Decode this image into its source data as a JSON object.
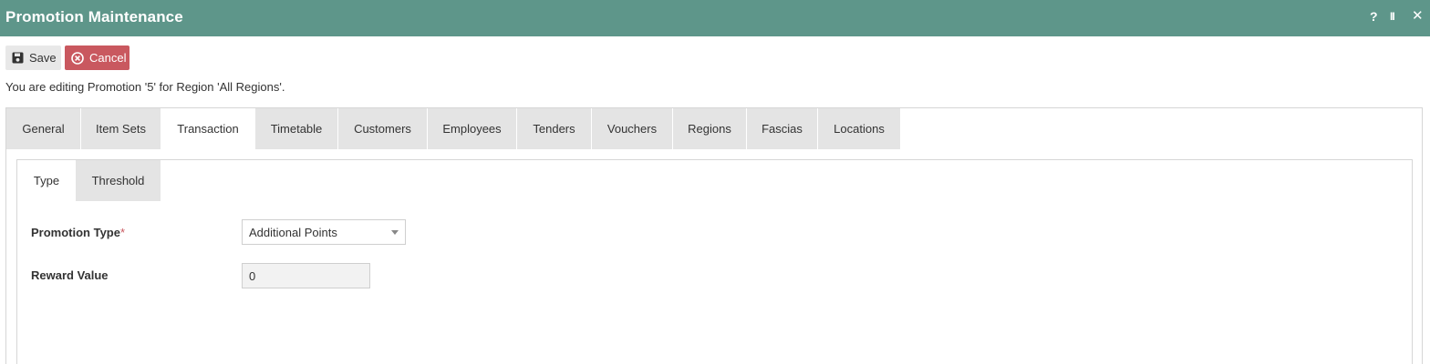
{
  "window": {
    "title": "Promotion Maintenance",
    "help_icon": "?",
    "pause_icon": "II",
    "close_icon": "✕"
  },
  "toolbar": {
    "save_label": "Save",
    "cancel_label": "Cancel",
    "save_icon": "floppy-disk-icon",
    "cancel_icon": "x-circle-icon"
  },
  "info_text": "You are editing Promotion '5' for Region 'All Regions'.",
  "main_tabs": [
    {
      "label": "General"
    },
    {
      "label": "Item Sets"
    },
    {
      "label": "Transaction",
      "active": true
    },
    {
      "label": "Timetable"
    },
    {
      "label": "Customers"
    },
    {
      "label": "Employees"
    },
    {
      "label": "Tenders"
    },
    {
      "label": "Vouchers"
    },
    {
      "label": "Regions"
    },
    {
      "label": "Fascias"
    },
    {
      "label": "Locations"
    }
  ],
  "sub_tabs": [
    {
      "label": "Type",
      "active": true
    },
    {
      "label": "Threshold"
    }
  ],
  "form": {
    "promotion_type": {
      "label": "Promotion Type",
      "required_marker": "*",
      "value": "Additional Points"
    },
    "reward_value": {
      "label": "Reward Value",
      "value": "0"
    }
  },
  "colors": {
    "titlebar": "#5e968a",
    "cancel": "#c9585f",
    "tab_inactive": "#e4e4e4"
  }
}
